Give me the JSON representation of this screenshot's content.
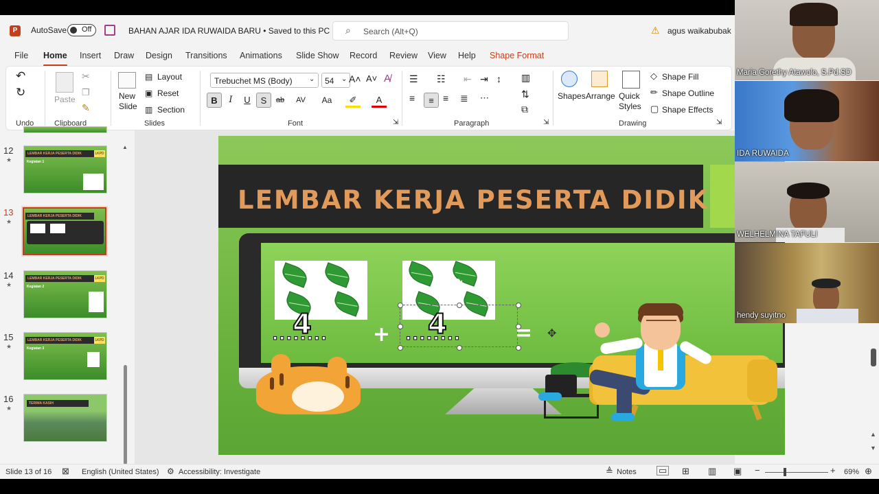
{
  "titlebar": {
    "autosave_label": "AutoSave",
    "autosave_state": "Off",
    "doc_title": "BAHAN AJAR IDA RUWAIDA BARU • Saved to this PC",
    "search_placeholder": "Search (Alt+Q)",
    "user_name": "agus waikabubak"
  },
  "tabs": [
    "File",
    "Home",
    "Insert",
    "Draw",
    "Design",
    "Transitions",
    "Animations",
    "Slide Show",
    "Record",
    "Review",
    "View",
    "Help",
    "Shape Format"
  ],
  "ribbon": {
    "undo_group": "Undo",
    "clipboard_group": "Clipboard",
    "paste_label": "Paste",
    "slides_group": "Slides",
    "new_slide_label": "New Slide",
    "layout_label": "Layout",
    "reset_label": "Reset",
    "section_label": "Section",
    "font_group": "Font",
    "font_name": "Trebuchet MS (Body)",
    "font_size": "54",
    "paragraph_group": "Paragraph",
    "drawing_group": "Drawing",
    "shapes_label": "Shapes",
    "arrange_label": "Arrange",
    "quick_styles_label": "Quick Styles",
    "shape_fill": "Shape Fill",
    "shape_outline": "Shape Outline",
    "shape_effects": "Shape Effects"
  },
  "thumbnails": [
    {
      "num": "12",
      "title": "LEMBAR KERJA PESERTA DIDIK",
      "badge": "LKPD",
      "sub": "Kegiatan 1"
    },
    {
      "num": "13",
      "title": "LEMBAR KERJA PESERTA DIDIK",
      "badge": "",
      "sub": ""
    },
    {
      "num": "14",
      "title": "LEMBAR KERJA PESERTA DIDIK",
      "badge": "LKPD",
      "sub": "Kegiatan 2"
    },
    {
      "num": "15",
      "title": "LEMBAR KERJA PESERTA DIDIK",
      "badge": "LKPD",
      "sub": "Kegiatan 3"
    },
    {
      "num": "16",
      "title": "TERIMA KASIH",
      "badge": "",
      "sub": ""
    }
  ],
  "slide": {
    "title": "LEMBAR KERJA PESERTA DIDIK",
    "left_number": "4",
    "right_number": "4",
    "dots": "........",
    "plus": "+",
    "equals": "="
  },
  "participants": [
    {
      "name": "Maria Gorethy Atawolo, S.Pd.SD"
    },
    {
      "name": "IDA RUWAIDA"
    },
    {
      "name": "WELHELMINA TAFULI"
    },
    {
      "name": "hendy suyitno"
    }
  ],
  "status": {
    "slide_counter": "Slide 13 of 16",
    "language": "English (United States)",
    "accessibility": "Accessibility: Investigate",
    "notes": "Notes",
    "zoom": "69%"
  }
}
